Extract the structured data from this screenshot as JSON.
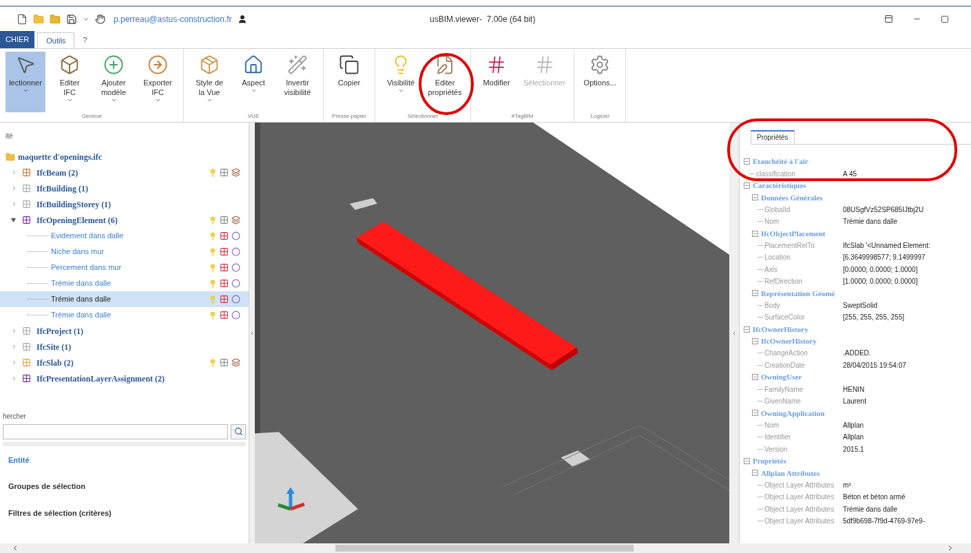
{
  "title_bar": {
    "account": "p.perreau@astus-construction.fr",
    "title": "usBIM.viewer‑  7.00e (64 bit)"
  },
  "tabs": [
    {
      "label": "CHIER",
      "kind": "file",
      "selected": false
    },
    {
      "label": "Outils",
      "kind": "tab",
      "selected": true
    },
    {
      "label": "?",
      "kind": "tab",
      "selected": false
    }
  ],
  "ribbon": [
    {
      "group": "Général",
      "buttons": [
        {
          "lines": [
            "lectionner"
          ],
          "dropdown": true,
          "selected": true,
          "disabled": false
        },
        {
          "lines": [
            "Editer",
            "IFC"
          ],
          "dropdown": true,
          "selected": false,
          "disabled": false
        },
        {
          "lines": [
            "Ajouter",
            "modèle"
          ],
          "dropdown": true,
          "selected": false,
          "disabled": false
        },
        {
          "lines": [
            "Exporter",
            "IFC"
          ],
          "dropdown": true,
          "selected": false,
          "disabled": false
        }
      ]
    },
    {
      "group": "VUE",
      "buttons": [
        {
          "lines": [
            "Style de",
            "la Vue"
          ],
          "dropdown": true,
          "selected": false,
          "disabled": false
        },
        {
          "lines": [
            "Aspect"
          ],
          "dropdown": true,
          "selected": false,
          "disabled": false
        },
        {
          "lines": [
            "Invertir",
            "visibilité"
          ],
          "dropdown": false,
          "selected": false,
          "disabled": false
        }
      ]
    },
    {
      "group": "Presse-papier",
      "buttons": [
        {
          "lines": [
            "Copier"
          ],
          "dropdown": false,
          "selected": false,
          "disabled": false
        }
      ]
    },
    {
      "group": "Sélectionner",
      "buttons": [
        {
          "lines": [
            "Visibilité"
          ],
          "dropdown": true,
          "selected": false,
          "disabled": false
        },
        {
          "lines": [
            "Editer",
            "propriétés"
          ],
          "dropdown": false,
          "selected": false,
          "disabled": false
        }
      ]
    },
    {
      "group": "#TagBIM",
      "buttons": [
        {
          "lines": [
            "Modifier"
          ],
          "dropdown": false,
          "selected": false,
          "disabled": false
        },
        {
          "lines": [
            "Sélectionner"
          ],
          "dropdown": false,
          "selected": false,
          "disabled": true
        }
      ]
    },
    {
      "group": "Logiciel",
      "buttons": [
        {
          "lines": [
            "Options..."
          ],
          "dropdown": false,
          "selected": false,
          "disabled": false
        }
      ]
    }
  ],
  "left_panel": {
    "header": "ité",
    "tree": {
      "label": "maquette d'openings.ifc",
      "children": [
        {
          "label": "IfcBeam (2)",
          "expanded": false,
          "controls": true
        },
        {
          "label": "IfcBuilding (1)",
          "expanded": false,
          "controls": false
        },
        {
          "label": "IfcBuildingStorey (1)",
          "expanded": false,
          "controls": false
        },
        {
          "label": "IfcOpeningElement (6)",
          "expanded": true,
          "controls": true,
          "children": [
            {
              "label": "Evidement dans dalle",
              "selected": false
            },
            {
              "label": "Niche dans mur",
              "selected": false
            },
            {
              "label": "Percement dans mur",
              "selected": false
            },
            {
              "label": "Trémie dans dalle",
              "selected": false
            },
            {
              "label": "Trémie dans dalle",
              "selected": true
            },
            {
              "label": "Trémie dans dalle",
              "selected": false
            }
          ]
        },
        {
          "label": "IfcProject (1)",
          "expanded": false,
          "controls": false
        },
        {
          "label": "IfcSite (1)",
          "expanded": false,
          "controls": false
        },
        {
          "label": "IfcSlab (2)",
          "expanded": false,
          "controls": true
        },
        {
          "label": "IfcPresentationLayerAssignment (2)",
          "expanded": false,
          "controls": false
        }
      ]
    },
    "search": {
      "label": "hercher"
    },
    "sections": [
      {
        "label": "Entité",
        "selected": true
      },
      {
        "label": "Groupes de sélection",
        "selected": false
      },
      {
        "label": "Filtres de sélection (critères)",
        "selected": false
      }
    ]
  },
  "properties": {
    "tab": "Propriétés",
    "tree": [
      {
        "kind": "group",
        "label": "Etanchéité à l'air",
        "expanded": true,
        "children": [
          {
            "kind": "property",
            "label": "classification",
            "value": "A 45"
          }
        ]
      },
      {
        "kind": "group",
        "label": "Caractéristiques",
        "expanded": true,
        "children": [
          {
            "kind": "group",
            "label": "Données Générales",
            "expanded": true,
            "children": [
              {
                "kind": "property",
                "label": "GlobalId",
                "value": "08USgfVz52SP685IJtbj2U"
              },
              {
                "kind": "property",
                "label": "Nom",
                "value": "Trémie dans dalle"
              }
            ]
          },
          {
            "kind": "group",
            "label": "IfcObjectPlacement",
            "expanded": true,
            "children": [
              {
                "kind": "property",
                "label": "PlacementRelTo",
                "value": "IfcSlab '<Unnamed Element:"
              },
              {
                "kind": "property",
                "label": "Location",
                "value": "[6.3649998577; 9.1499997"
              },
              {
                "kind": "property",
                "label": "Axis",
                "value": "[0.0000; 0.0000; 1.0000]"
              },
              {
                "kind": "property",
                "label": "RefDirection",
                "value": "[1.0000; 0.0000; 0.0000]"
              }
            ]
          },
          {
            "kind": "group",
            "label": "Représentation Géomé",
            "expanded": true,
            "children": [
              {
                "kind": "property",
                "label": "Body",
                "value": "SweptSolid"
              },
              {
                "kind": "property",
                "label": "SurfaceColor",
                "value": "[255, 255, 255, 255]"
              }
            ]
          }
        ]
      },
      {
        "kind": "group",
        "label": "IfcOwnerHistory",
        "expanded": true,
        "children": [
          {
            "kind": "group",
            "label": "IfcOwnerHistory",
            "expanded": true,
            "children": [
              {
                "kind": "property",
                "label": "ChangeAction",
                "value": ".ADDED."
              },
              {
                "kind": "property",
                "label": "CreationDate",
                "value": "28/04/2015 19:54:07"
              }
            ]
          },
          {
            "kind": "group",
            "label": "OwningUser",
            "expanded": true,
            "children": [
              {
                "kind": "property",
                "label": "FamilyName",
                "value": "HENIN"
              },
              {
                "kind": "property",
                "label": "GivenName",
                "value": "Laurent"
              }
            ]
          },
          {
            "kind": "group",
            "label": "OwningApplication",
            "expanded": true,
            "children": [
              {
                "kind": "property",
                "label": "Nom",
                "value": "Allplan"
              },
              {
                "kind": "property",
                "label": "Identifier",
                "value": "Allplan"
              },
              {
                "kind": "property",
                "label": "Version",
                "value": "2015.1"
              }
            ]
          }
        ]
      },
      {
        "kind": "group",
        "label": "Propriétés",
        "expanded": true,
        "children": [
          {
            "kind": "group",
            "label": "Allplan Attributes",
            "expanded": true,
            "children": [
              {
                "kind": "property",
                "label": "Object Layer Attributes",
                "value": "m³"
              },
              {
                "kind": "property",
                "label": "Object Layer Attributes",
                "value": "Béton et béton armé"
              },
              {
                "kind": "property",
                "label": "Object Layer Attributes",
                "value": "Trémie dans dalle"
              },
              {
                "kind": "property",
                "label": "Object Layer Attributes",
                "value": "5df9b698-7f9d-4769-97e9-"
              }
            ]
          }
        ]
      }
    ]
  }
}
